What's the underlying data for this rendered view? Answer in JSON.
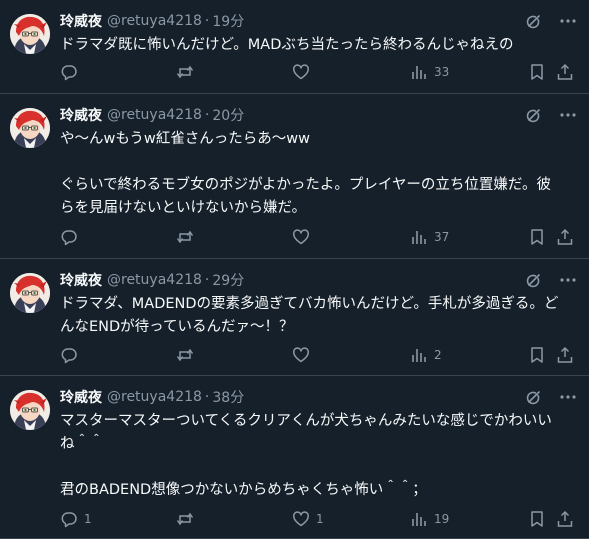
{
  "tweets": [
    {
      "name": "玲威夜",
      "handle": "@retuya4218",
      "dot": "·",
      "time": "19分",
      "text": "ドラマダ既に怖いんだけど。MADぶち当たったら終わるんじゃねえの",
      "replies": "",
      "retweets": "",
      "likes": "",
      "views": "33"
    },
    {
      "name": "玲威夜",
      "handle": "@retuya4218",
      "dot": "·",
      "time": "20分",
      "text": "や〜んwもうw紅雀さんったらあ〜ww\n\nぐらいで終わるモブ女のポジがよかったよ。プレイヤーの立ち位置嫌だ。彼\nらを見届けないといけないから嫌だ。",
      "replies": "",
      "retweets": "",
      "likes": "",
      "views": "37"
    },
    {
      "name": "玲威夜",
      "handle": "@retuya4218",
      "dot": "·",
      "time": "29分",
      "text": "ドラマダ、MADENDの要素多過ぎてバカ怖いんだけど。手札が多過ぎる。ど\nんなENDが待っているんだァ〜！？",
      "replies": "",
      "retweets": "",
      "likes": "",
      "views": "2"
    },
    {
      "name": "玲威夜",
      "handle": "@retuya4218",
      "dot": "·",
      "time": "38分",
      "text": "マスターマスターついてくるクリアくんが犬ちゃんみたいな感じでかわいい\nね＾＾\n\n君のBADEND想像つかないからめちゃくちゃ怖い＾＾；",
      "replies": "1",
      "retweets": "",
      "likes": "1",
      "views": "19"
    }
  ],
  "icons": {
    "grok": "grok-icon",
    "more": "more-icon",
    "reply": "reply-icon",
    "retweet": "retweet-icon",
    "like": "like-icon",
    "views": "views-icon",
    "bookmark": "bookmark-icon",
    "share": "share-icon"
  },
  "colors": {
    "background": "#15202b",
    "text": "#f7f9f9",
    "secondary": "#8b98a5",
    "border": "#38444d"
  }
}
